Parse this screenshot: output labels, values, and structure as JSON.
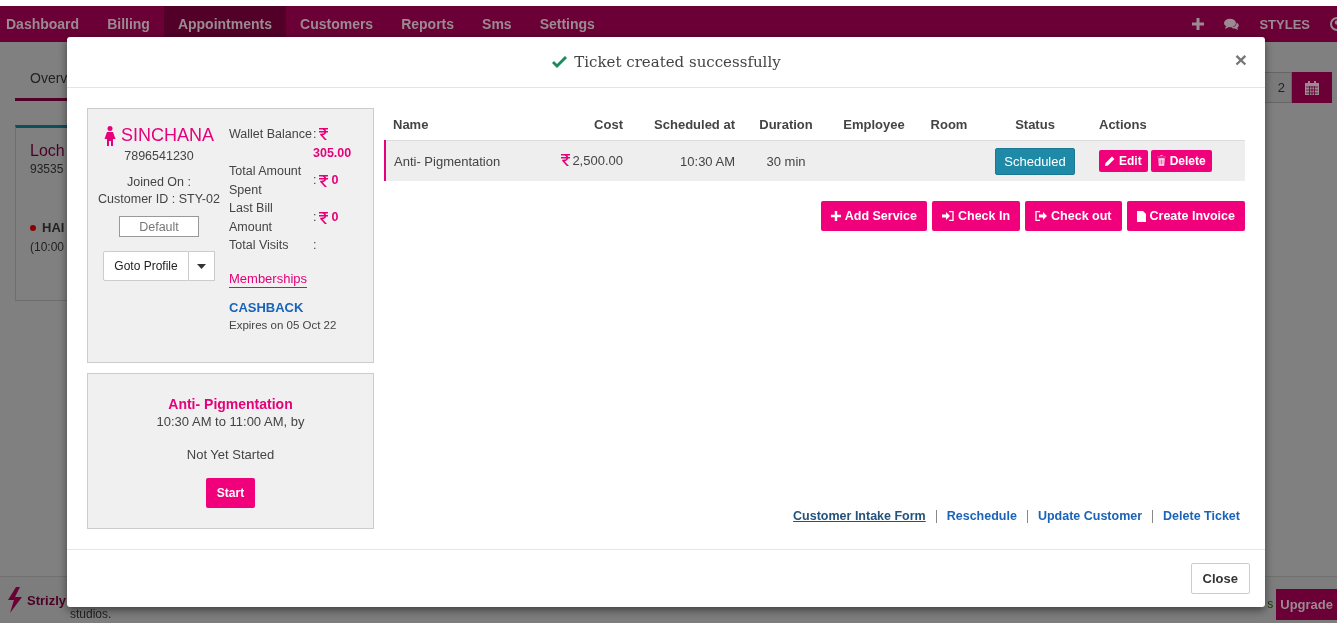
{
  "top_nav": {
    "items": [
      {
        "label": "Dashboard",
        "selected": false
      },
      {
        "label": "Billing",
        "selected": false
      },
      {
        "label": "Appointments",
        "selected": true
      },
      {
        "label": "Customers",
        "selected": false
      },
      {
        "label": "Reports",
        "selected": false
      },
      {
        "label": "Sms",
        "selected": false
      },
      {
        "label": "Settings",
        "selected": false
      }
    ],
    "right_label": "STYLES"
  },
  "background": {
    "tab": "Overv",
    "card": {
      "title": "Loch",
      "phone": "93535",
      "event": "HAI",
      "time": "(10:00"
    },
    "date_value": "2",
    "logo": "Strizly",
    "footer_text": "studios.",
    "fragment": "s",
    "upgrade": "Upgrade"
  },
  "modal": {
    "title": "Ticket created successfully",
    "close_glyph": "×",
    "customer": {
      "name": "SINCHANA",
      "phone": "7896541230",
      "joined": "Joined On :",
      "customer_id": "Customer ID : STY-02",
      "default_button": "Default",
      "profile_button": "Goto Profile",
      "separator": ":",
      "stats": [
        {
          "label": "Wallet Balance",
          "value": "305.00"
        },
        {
          "label": "Total Amount Spent",
          "value": "0"
        },
        {
          "label": "Last Bill Amount",
          "value": "0"
        },
        {
          "label": "Total Visits"
        }
      ],
      "memberships_link": "Memberships",
      "membership": "CASHBACK",
      "expires": "Expires on 05 Oct 22"
    },
    "appointment": {
      "service": "Anti- Pigmentation",
      "time": "10:30 AM to 11:00 AM, by",
      "status": "Not Yet Started",
      "button": "Start"
    },
    "table": {
      "columns": [
        "Name",
        "Cost",
        "Scheduled at",
        "Duration",
        "Employee",
        "Room",
        "Status",
        "Actions"
      ],
      "rows": [
        {
          "name": "Anti- Pigmentation",
          "cost": "2,500.00",
          "scheduled_at": "10:30 AM",
          "duration": "30 min",
          "status": "Scheduled",
          "actions": [
            {
              "label": "Edit",
              "kind": "edit"
            },
            {
              "label": "Delete",
              "kind": "delete"
            }
          ]
        }
      ]
    },
    "buttons": [
      {
        "label": "Add Service",
        "kind": "add"
      },
      {
        "label": "Check In",
        "kind": "check-in"
      },
      {
        "label": "Check out",
        "kind": "check-out"
      },
      {
        "label": "Create Invoice",
        "kind": "invoice"
      }
    ],
    "links": [
      {
        "label": "Customer Intake Form",
        "focused": true
      },
      {
        "label": "Reschedule",
        "focused": false
      },
      {
        "label": "Update Customer",
        "focused": false
      },
      {
        "label": "Delete Ticket",
        "focused": false
      }
    ],
    "footer_button": "Close"
  }
}
